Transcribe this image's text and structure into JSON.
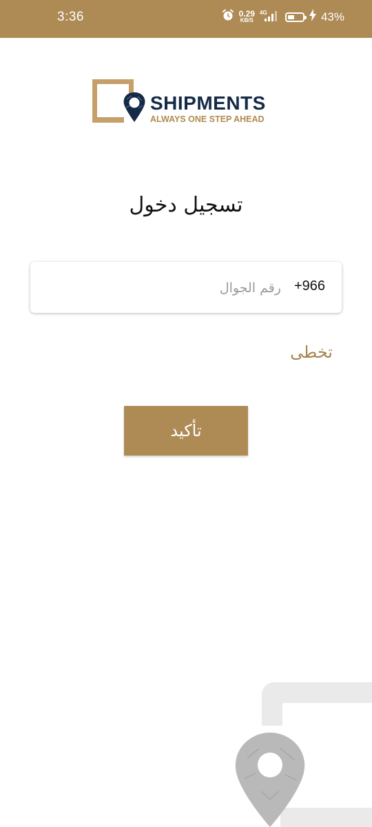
{
  "status_bar": {
    "time": "3:36",
    "net_speed": "0.29",
    "net_unit": "KB/S",
    "network": "4G",
    "battery": "43%",
    "icons": [
      "alarm-icon",
      "signal-icon",
      "battery-icon",
      "charging-icon"
    ]
  },
  "logo": {
    "name": "SHIPMENTS",
    "tagline": "ALWAYS ONE STEP AHEAD"
  },
  "title": "تسجيل دخول",
  "phone": {
    "country_code": "+966",
    "placeholder": "رقم الجوال",
    "value": ""
  },
  "skip": "تخطى",
  "confirm": "تأكيد",
  "colors": {
    "primary": "#ae8a55",
    "navy": "#142a47",
    "watermark": "#e8e8e8"
  }
}
